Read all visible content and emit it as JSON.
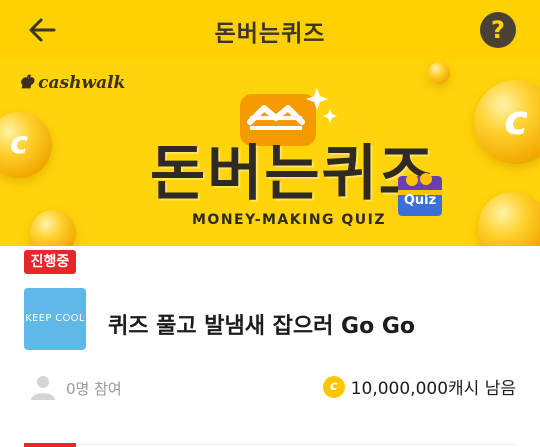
{
  "app_bar": {
    "title": "돈버는퀴즈",
    "back_icon": "arrow-left-icon",
    "help_label": "?",
    "background_color": "#FFD100"
  },
  "banner": {
    "brand": "cashwalk",
    "title": "돈버는퀴즈",
    "subtitle": "MONEY-MAKING QUIZ",
    "badge_label": "Quiz",
    "coin_letter": "c"
  },
  "quiz": {
    "status": "진행중",
    "sponsor_logo_text": "KEEP COOL",
    "title": "퀴즈 풀고 발냄새 잡으러 Go Go",
    "participants": "0명 참여",
    "reward_coin_letter": "c",
    "reward": "10,000,000캐시 남음"
  },
  "colors": {
    "accent_yellow": "#FFD100",
    "status_red": "#E8262A",
    "sponsor_blue": "#5FB8E8"
  }
}
